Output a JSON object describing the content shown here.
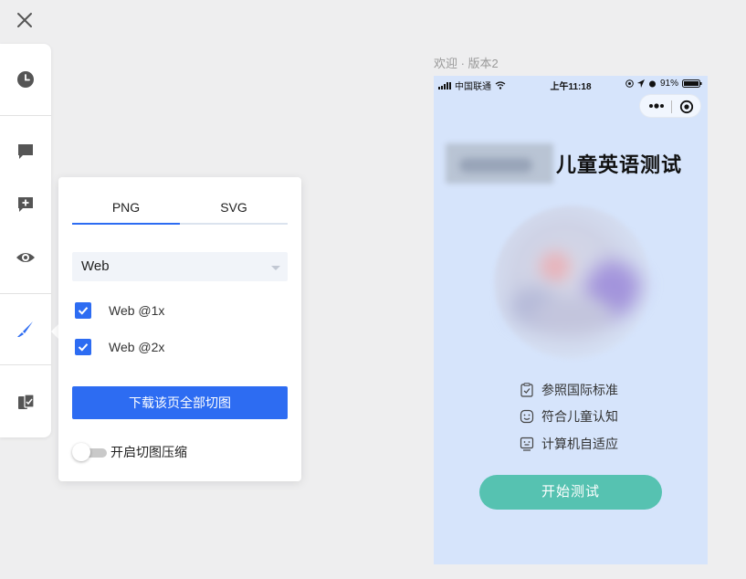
{
  "colors": {
    "accent": "#2d6cf2",
    "start_button": "#56c2b1",
    "phone_background": "#d6e4fb",
    "canvas_background": "#eeeeef"
  },
  "toolbar": {
    "close_icon": "close-icon",
    "tools": [
      {
        "icon": "clock-icon",
        "name": "history"
      },
      {
        "icon": "comment-icon",
        "name": "comments"
      },
      {
        "icon": "add-comment-icon",
        "name": "add-annotation"
      },
      {
        "icon": "eye-icon",
        "name": "preview"
      },
      {
        "icon": "knife-icon",
        "name": "slice-export",
        "active": true
      },
      {
        "icon": "cards-icon",
        "name": "assets"
      }
    ]
  },
  "export_panel": {
    "tabs": [
      {
        "label": "PNG",
        "active": true
      },
      {
        "label": "SVG",
        "active": false
      }
    ],
    "platform_select": {
      "value": "Web"
    },
    "scales": [
      {
        "label": "Web @1x",
        "checked": true
      },
      {
        "label": "Web @2x",
        "checked": true
      }
    ],
    "download_button": "下载该页全部切图",
    "compress_toggle": {
      "label": "开启切图压缩",
      "on": false
    }
  },
  "artboard": {
    "title": "欢迎 · 版本2",
    "status_bar": {
      "carrier": "中国联通",
      "time": "上午11:18",
      "battery": "91%"
    },
    "heading": "儿童英语测试",
    "features": [
      {
        "icon": "clipboard-check-icon",
        "label": "参照国际标准"
      },
      {
        "icon": "smile-face-icon",
        "label": "符合儿童认知"
      },
      {
        "icon": "computer-face-icon",
        "label": "计算机自适应"
      }
    ],
    "start_button": "开始测试"
  }
}
